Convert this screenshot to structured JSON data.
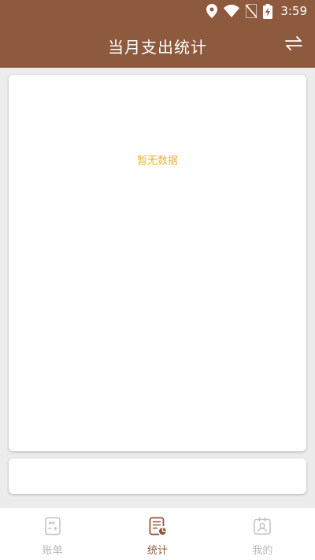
{
  "status_bar": {
    "time": "3:59"
  },
  "header": {
    "title": "当月支出统计"
  },
  "chart": {
    "empty_text": "暂无数据"
  },
  "bottom_nav": {
    "items": [
      {
        "label": "账单",
        "icon": "bill-icon",
        "active": false
      },
      {
        "label": "统计",
        "icon": "stats-icon",
        "active": true
      },
      {
        "label": "我的",
        "icon": "profile-icon",
        "active": false
      }
    ]
  },
  "colors": {
    "primary": "#8e5a3d",
    "empty_text": "#e8b33a",
    "nav_inactive": "#b8b8b8",
    "background": "#ececec"
  }
}
